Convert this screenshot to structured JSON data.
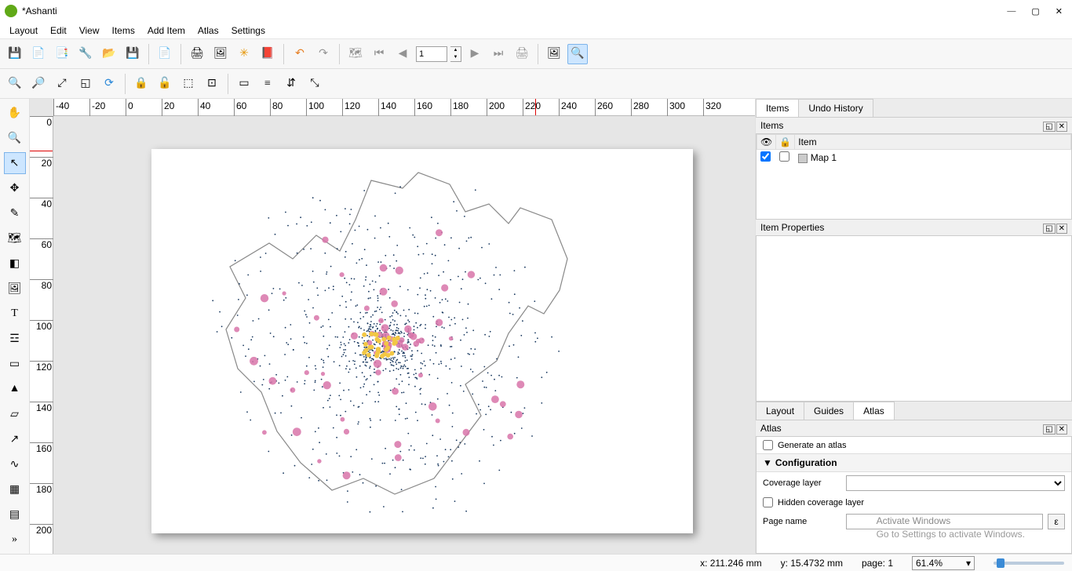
{
  "window": {
    "title": "*Ashanti"
  },
  "menubar": [
    "Layout",
    "Edit",
    "View",
    "Items",
    "Add Item",
    "Atlas",
    "Settings"
  ],
  "toolbar1": {
    "page_current": "1"
  },
  "ruler_h": [
    "-40",
    "-20",
    "0",
    "20",
    "40",
    "60",
    "80",
    "100",
    "120",
    "140",
    "160",
    "180",
    "200",
    "220",
    "240",
    "260",
    "280",
    "300",
    "320"
  ],
  "ruler_v": [
    "0",
    "20",
    "40",
    "60",
    "80",
    "100",
    "120",
    "140",
    "160",
    "180",
    "200"
  ],
  "items_panel": {
    "tab_items": "Items",
    "tab_undo": "Undo History",
    "title": "Items",
    "col_item": "Item",
    "rows": [
      {
        "checked": true,
        "locked": false,
        "name": "Map 1"
      }
    ]
  },
  "item_properties": {
    "title": "Item Properties"
  },
  "bottom_tabs": {
    "layout": "Layout",
    "guides": "Guides",
    "atlas": "Atlas"
  },
  "atlas": {
    "title": "Atlas",
    "generate": "Generate an atlas",
    "config_header": "Configuration",
    "coverage_label": "Coverage layer",
    "hidden_label": "Hidden coverage layer",
    "page_name_label": "Page name",
    "epsilon_btn": "ε"
  },
  "status": {
    "x": "x: 211.246 mm",
    "y": "y: 15.4732 mm",
    "page": "page: 1",
    "zoom": "61.4%"
  },
  "watermark": {
    "l1": "Activate Windows",
    "l2": "Go to Settings to activate Windows."
  }
}
